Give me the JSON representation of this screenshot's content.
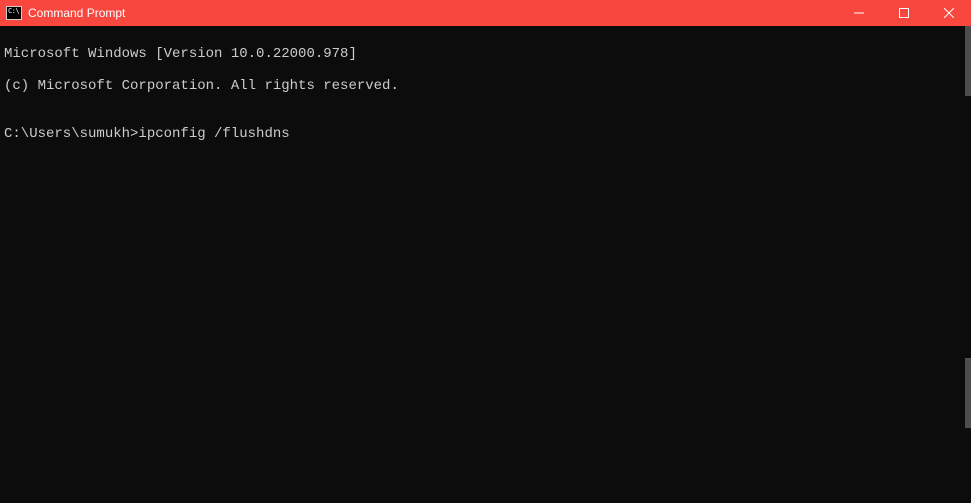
{
  "titlebar": {
    "title": "Command Prompt",
    "icon_text": "C:\\"
  },
  "terminal": {
    "line1": "Microsoft Windows [Version 10.0.22000.978]",
    "line2": "(c) Microsoft Corporation. All rights reserved.",
    "blank": "",
    "prompt": "C:\\Users\\sumukh>",
    "command": "ipconfig /flushdns"
  }
}
